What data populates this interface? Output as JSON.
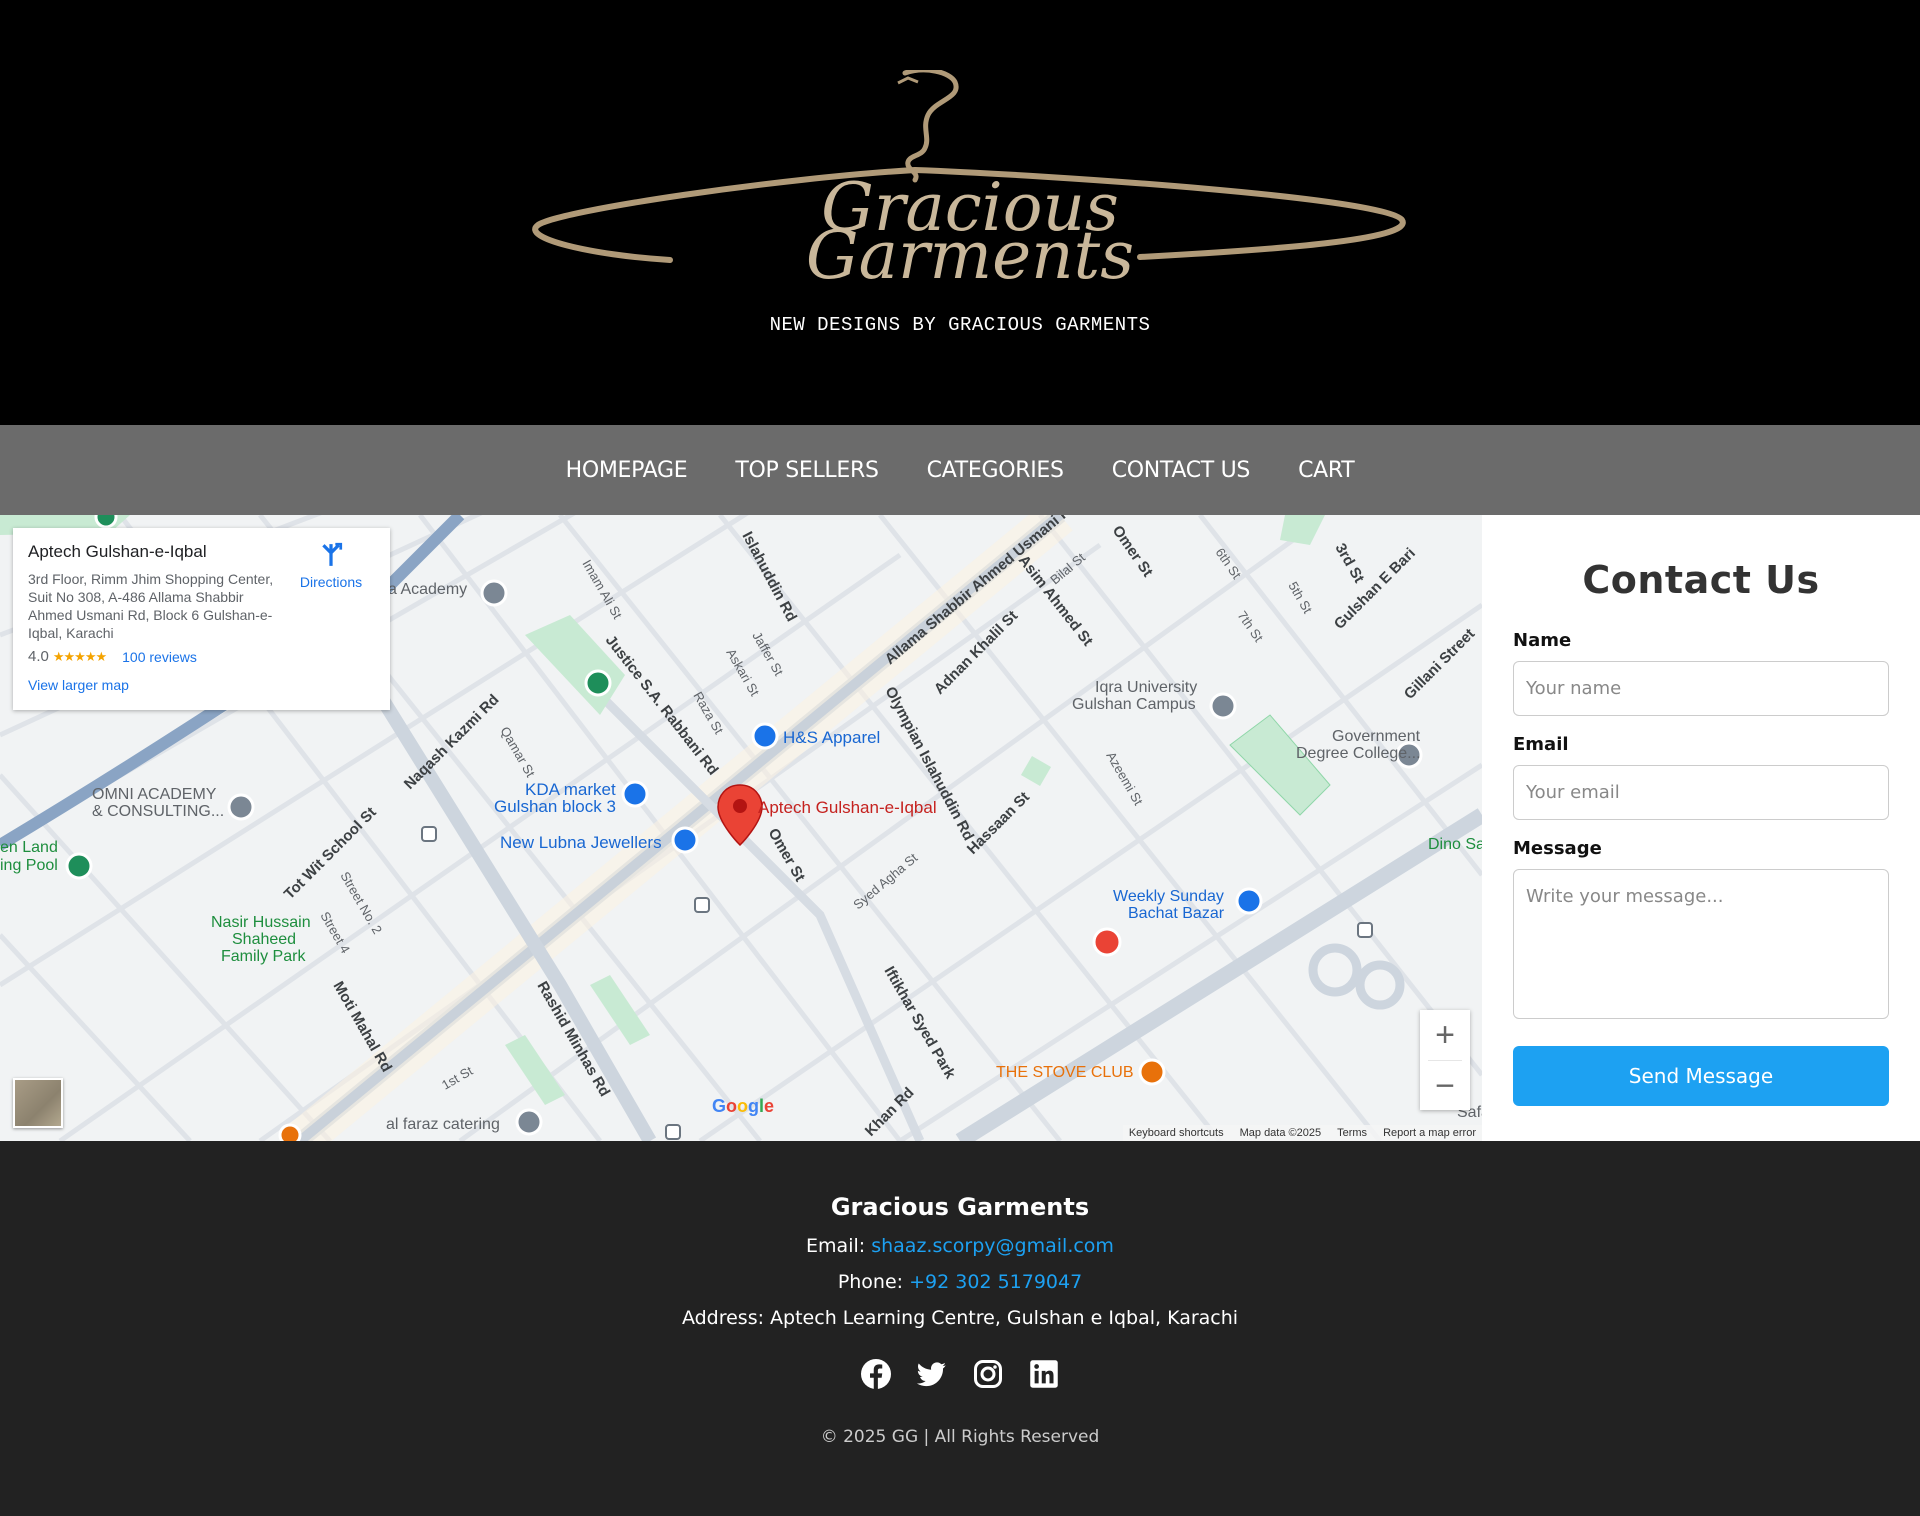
{
  "header": {
    "logo_text_line1": "Gracious",
    "logo_text_line2": "Garments",
    "tagline": "NEW DESIGNS BY GRACIOUS GARMENTS"
  },
  "nav": {
    "items": [
      "HOMEPAGE",
      "TOP SELLERS",
      "CATEGORIES",
      "CONTACT US",
      "CART"
    ]
  },
  "map": {
    "place_card": {
      "title": "Aptech Gulshan-e-Iqbal",
      "address": "3rd Floor, Rimm Jhim Shopping Center, Suit No 308, A-486 Allama Shabbir Ahmed Usmani Rd, Block 6 Gulshan-e-Iqbal, Karachi",
      "rating": "4.0",
      "rating_value": 4.0,
      "stars": "★★★★★",
      "reviews": "100 reviews",
      "view_larger": "View larger map",
      "directions": "Directions"
    },
    "labels": {
      "pin": "Aptech Gulshan-e-Iqbal",
      "hs": "H&S Apparel",
      "kda1": "KDA market",
      "kda2": "Gulshan block 3",
      "lubna": "New Lubna Jewellers",
      "omni1": "OMNI ACADEMY",
      "omni2": "& CONSULTING...",
      "nasir1": "Nasir Hussain",
      "nasir2": "Shaheed",
      "nasir3": "Family Park",
      "iqra1": "Iqra University",
      "iqra2": "Gulshan Campus",
      "gov1": "Government",
      "gov2": "Degree College...",
      "weekly1": "Weekly Sunday",
      "weekly2": "Bachat Bazar",
      "stove": "THE STOVE CLUB",
      "alfaraz": "al faraz catering",
      "academy": "a Academy",
      "dino": "Dino Sa",
      "land1": "en Land",
      "land2": "ing Pool",
      "usmani": "Allama Shabbir Ahmed Usmani Rd",
      "justice": "Justice S.A. Rabbani Rd",
      "olympian": "Olympian Islahuddin Rd",
      "rashid": "Rashid Minhas Rd",
      "iftikhar": "Iftikhar Syed Park",
      "naqash": "Naqash Kazmi Rd",
      "totwit": "Tot Wit School St",
      "moti": "Moti Mahal Rd",
      "omer": "Omer St",
      "omer2": "Omer St",
      "hassaan": "Hassaan St",
      "adnan": "Adnan Khalil St",
      "asim": "Asim Ahmed St",
      "khan": "Khan Rd",
      "syedagha": "Syed Agha St",
      "gulshanbari": "Gulshan E Bari",
      "gillani": "Gillani Street",
      "st3": "3rd St",
      "st5": "5th St",
      "st6": "6th St",
      "st7": "7th St",
      "st1": "1st St",
      "jaffer": "Jaffer St",
      "askari": "Askari St",
      "raza": "Raza St",
      "qamar": "Qamar St",
      "azeemi": "Azeemi St",
      "islahuddin": "Islahuddin Rd",
      "imamali": "Imam Ali St",
      "bilal": "Bilal St",
      "street2": "Street No. 2",
      "street4": "Street 4",
      "safa": "Safa"
    },
    "google": "Google",
    "footer_links": [
      "Keyboard shortcuts",
      "Map data ©2025",
      "Terms",
      "Report a map error"
    ]
  },
  "contact": {
    "title": "Contact Us",
    "name_label": "Name",
    "name_placeholder": "Your name",
    "email_label": "Email",
    "email_placeholder": "Your email",
    "message_label": "Message",
    "message_placeholder": "Write your message...",
    "send": "Send Message"
  },
  "footer": {
    "title": "Gracious Garments",
    "email_label": "Email:",
    "email": "shaaz.scorpy@gmail.com",
    "phone_label": "Phone:",
    "phone": "+92 302 5179047",
    "address": "Address: Aptech Learning Centre, Gulshan e Iqbal, Karachi",
    "copyright": "© 2025 GG | All Rights Reserved",
    "social_icons": [
      "facebook-icon",
      "twitter-icon",
      "instagram-icon",
      "linkedin-icon"
    ]
  },
  "colors": {
    "accent": "#1da1f2",
    "nav_bg": "#6b6b6b",
    "footer_bg": "#222222",
    "logo_gold": "#b09a78"
  }
}
